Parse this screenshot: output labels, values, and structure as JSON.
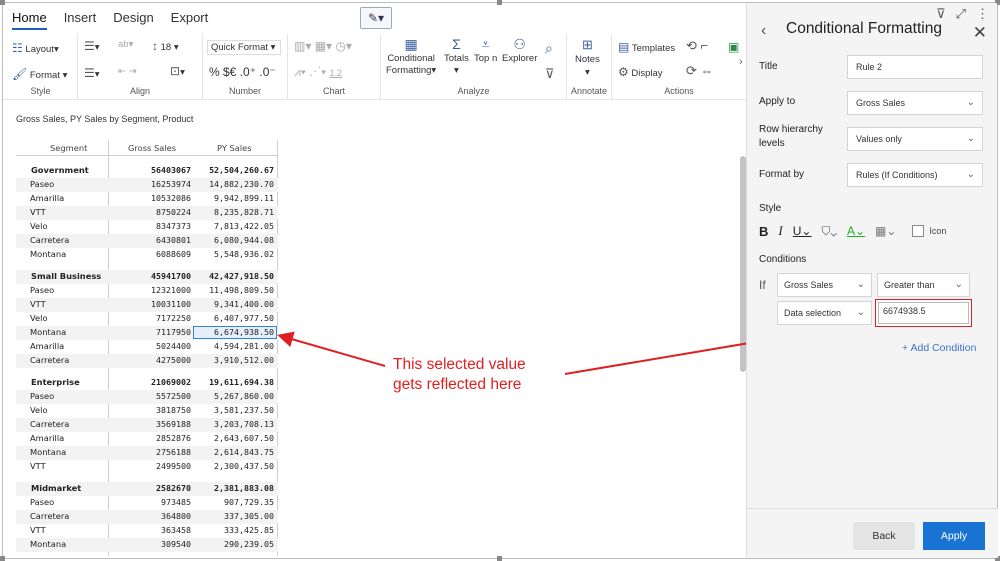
{
  "ribbon": {
    "tabs": [
      "Home",
      "Insert",
      "Design",
      "Export"
    ],
    "style": {
      "layout": "Layout",
      "format": "Format",
      "label": "Style"
    },
    "align": {
      "font_size": "18",
      "label": "Align"
    },
    "number": {
      "quick_format": "Quick Format",
      "symbols": "% $€ .0⁺ .0⁻",
      "label": "Number"
    },
    "chart": {
      "scale": "1.2",
      "label": "Chart"
    },
    "analyze": {
      "conditional": "Conditional",
      "formatting": "Formatting",
      "totals": "Totals",
      "topn": "Top n",
      "explorer": "Explorer",
      "label": "Analyze"
    },
    "annotate": {
      "notes": "Notes",
      "label": "Annotate"
    },
    "actions": {
      "templates": "Templates",
      "display": "Display",
      "label": "Actions"
    }
  },
  "report": {
    "title": "Gross Sales, PY Sales by Segment, Product",
    "columns": [
      "Segment",
      "Gross Sales",
      "PY Sales"
    ],
    "rows": [
      {
        "segment": "Government",
        "gs": "56403067",
        "py": "52,504,260.67",
        "group": true
      },
      {
        "segment": "Paseo",
        "gs": "16253974",
        "py": "14,882,230.70"
      },
      {
        "segment": "Amarilla",
        "gs": "10532086",
        "py": "9,942,899.11"
      },
      {
        "segment": "VTT",
        "gs": "8750224",
        "py": "8,235,828.71"
      },
      {
        "segment": "Velo",
        "gs": "8347373",
        "py": "7,813,422.05"
      },
      {
        "segment": "Carretera",
        "gs": "6430801",
        "py": "6,080,944.08"
      },
      {
        "segment": "Montana",
        "gs": "6088609",
        "py": "5,548,936.02"
      },
      {
        "segment": "Small Business",
        "gs": "45941700",
        "py": "42,427,918.50",
        "group": true
      },
      {
        "segment": "Paseo",
        "gs": "12321000",
        "py": "11,498,809.50"
      },
      {
        "segment": "VTT",
        "gs": "10031100",
        "py": "9,341,400.00"
      },
      {
        "segment": "Velo",
        "gs": "7172250",
        "py": "6,407,977.50"
      },
      {
        "segment": "Montana",
        "gs": "7117950",
        "py": "6,674,938.50",
        "selected": true
      },
      {
        "segment": "Amarilla",
        "gs": "5024400",
        "py": "4,594,281.00"
      },
      {
        "segment": "Carretera",
        "gs": "4275000",
        "py": "3,910,512.00"
      },
      {
        "segment": "Enterprise",
        "gs": "21069002",
        "py": "19,611,694.38",
        "group": true
      },
      {
        "segment": "Paseo",
        "gs": "5572500",
        "py": "5,267,860.00"
      },
      {
        "segment": "Velo",
        "gs": "3818750",
        "py": "3,581,237.50"
      },
      {
        "segment": "Carretera",
        "gs": "3569188",
        "py": "3,203,708.13"
      },
      {
        "segment": "Amarilla",
        "gs": "2852876",
        "py": "2,643,607.50"
      },
      {
        "segment": "Montana",
        "gs": "2756188",
        "py": "2,614,843.75"
      },
      {
        "segment": "VTT",
        "gs": "2499500",
        "py": "2,300,437.50"
      },
      {
        "segment": "Midmarket",
        "gs": "2582670",
        "py": "2,381,883.08",
        "group": true
      },
      {
        "segment": "Paseo",
        "gs": "973485",
        "py": "907,729.35"
      },
      {
        "segment": "Carretera",
        "gs": "364800",
        "py": "337,305.00"
      },
      {
        "segment": "VTT",
        "gs": "363458",
        "py": "333,425.85"
      },
      {
        "segment": "Montana",
        "gs": "309540",
        "py": "290,239.05"
      }
    ]
  },
  "annotation": {
    "line1": "This selected value",
    "line2": "gets reflected here"
  },
  "panel": {
    "title": "Conditional Formatting",
    "title_label": "Title",
    "title_value": "Rule 2",
    "apply_to_label": "Apply to",
    "apply_to_value": "Gross Sales",
    "row_hier_label": "Row hierarchy levels",
    "row_hier_value": "Values only",
    "format_by_label": "Format by",
    "format_by_value": "Rules (If Conditions)",
    "style_label": "Style",
    "icon_label": "Icon",
    "conditions_label": "Conditions",
    "if_label": "If",
    "cond_field": "Gross Sales",
    "cond_operator": "Greater than",
    "cond_source": "Data selection",
    "cond_value": "6674938.5",
    "add_condition": "+ Add Condition",
    "back_button": "Back",
    "apply_button": "Apply"
  }
}
